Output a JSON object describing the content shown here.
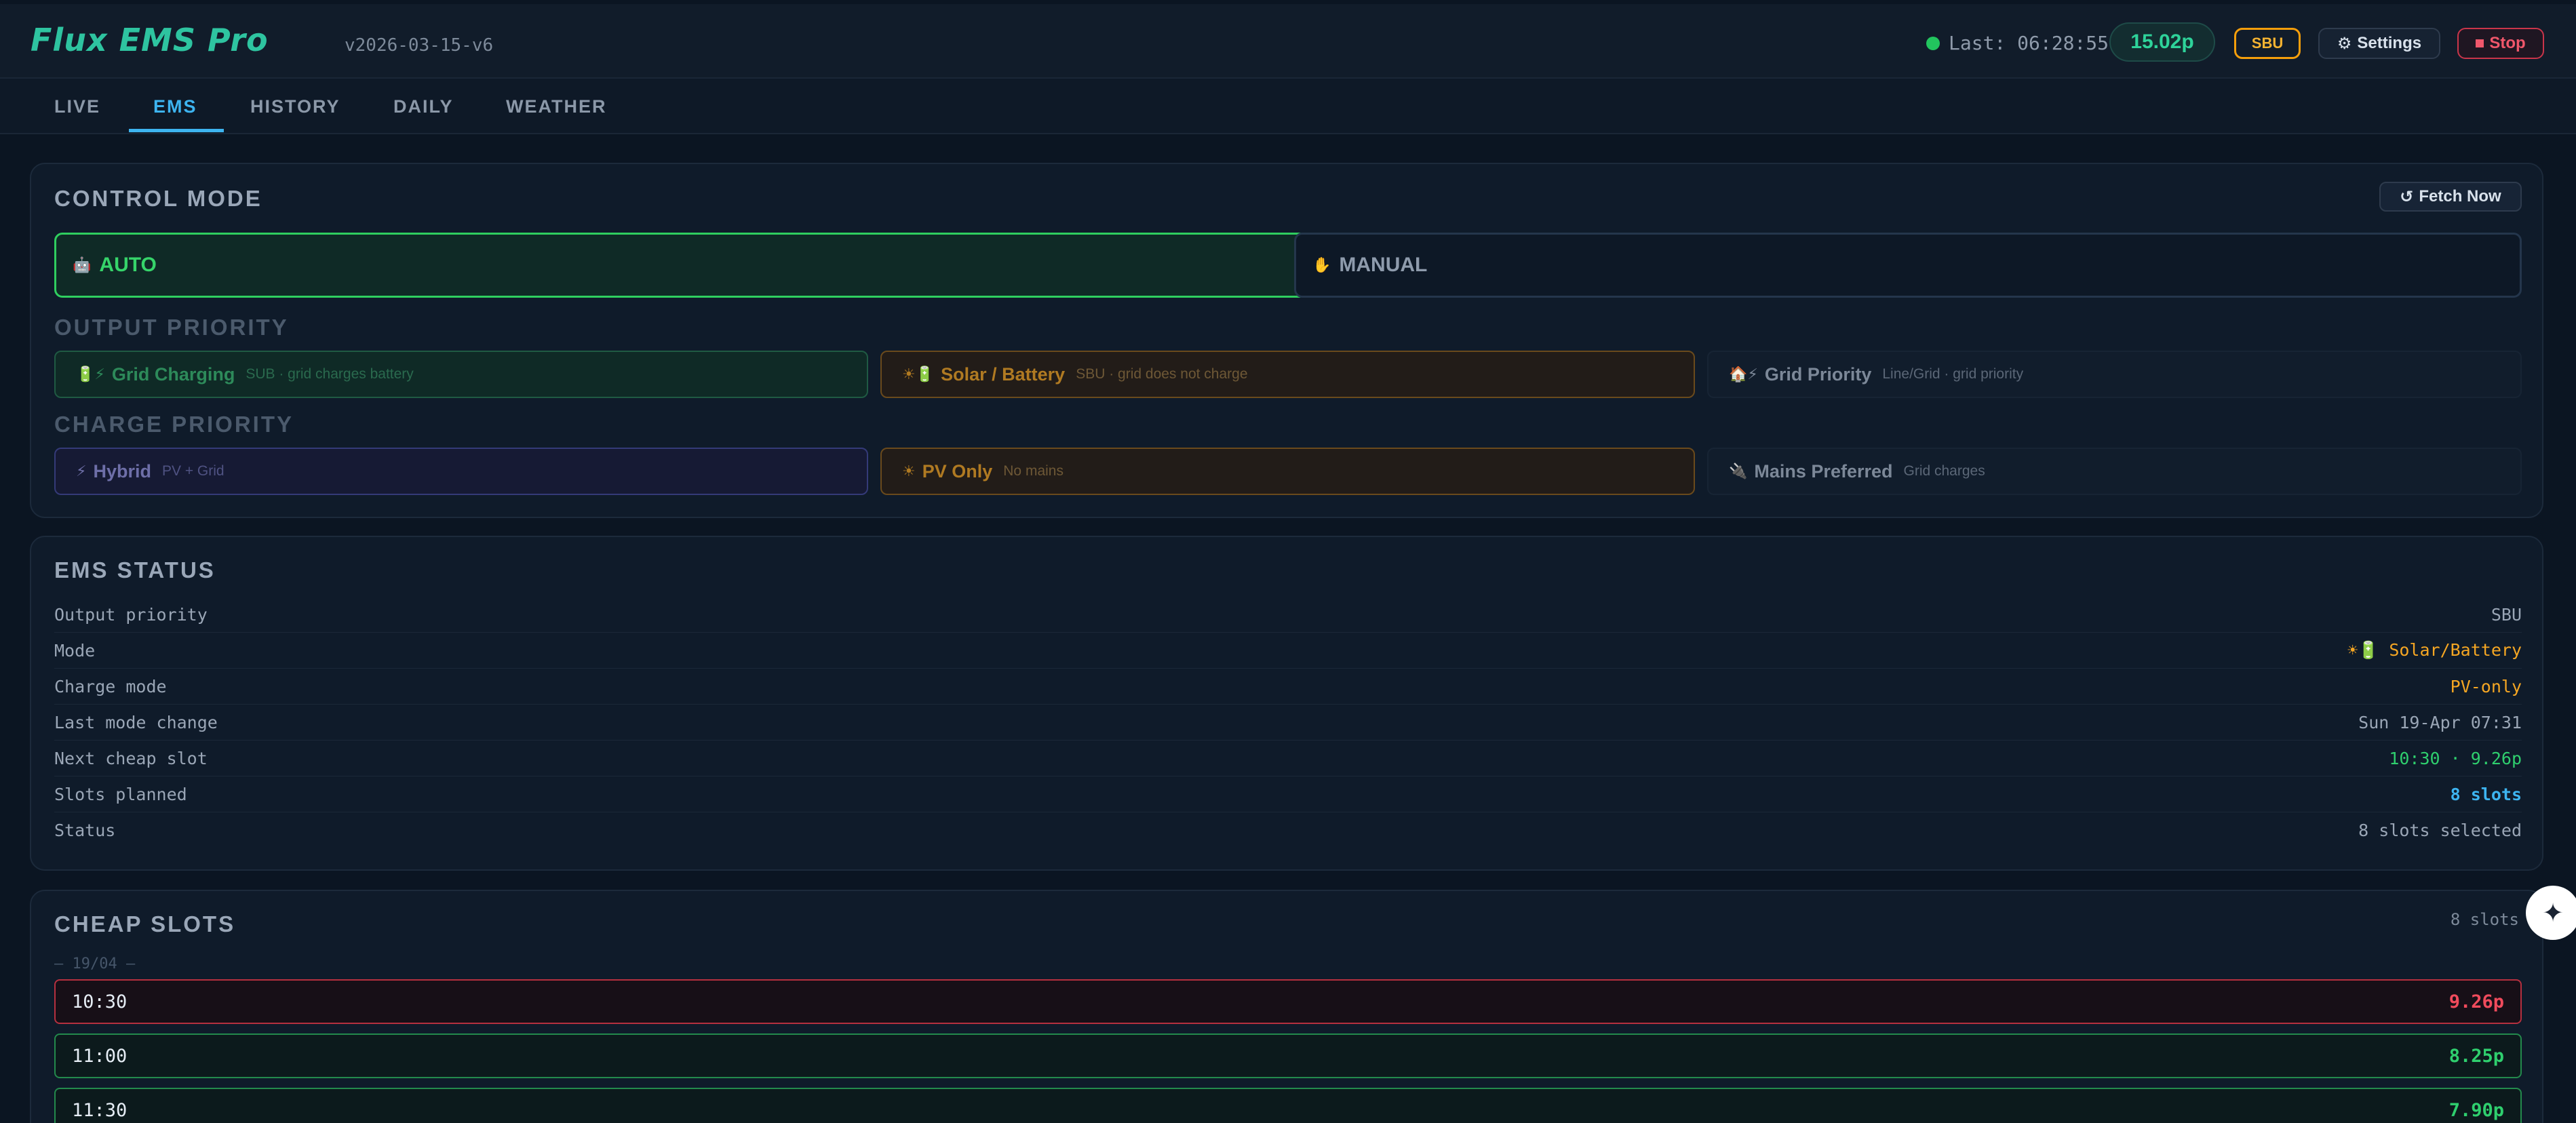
{
  "header": {
    "logo": "Flux EMS Pro",
    "version": "v2026-03-15-v6",
    "last_updated": "Last: 06:28:55",
    "price": "15.02p",
    "mode_badge": "SBU",
    "settings_label": "Settings",
    "stop_label": "Stop",
    "colors": {
      "accent": "#3db4f0",
      "success": "#22c55e",
      "warning": "#f59e0b",
      "danger": "#f0576b"
    }
  },
  "tabs": [
    {
      "label": "LIVE"
    },
    {
      "label": "EMS"
    },
    {
      "label": "HISTORY"
    },
    {
      "label": "DAILY"
    },
    {
      "label": "WEATHER"
    }
  ],
  "active_tab": "EMS",
  "control": {
    "title": "CONTROL MODE",
    "fetch_label": "Fetch Now",
    "auto_label": "AUTO",
    "manual_label": "MANUAL",
    "selected": "AUTO",
    "output_title": "OUTPUT PRIORITY",
    "output_options": [
      {
        "label": "Grid Charging",
        "desc": "SUB · grid charges battery",
        "icon": "battery-lightning-icon"
      },
      {
        "label": "Solar / Battery",
        "desc": "SBU · grid does not charge",
        "icon": "sun-battery-icon"
      },
      {
        "label": "Grid Priority",
        "desc": "Line/Grid · grid priority",
        "icon": "house-lightning-icon"
      }
    ],
    "charge_title": "CHARGE PRIORITY",
    "charge_options": [
      {
        "label": "Hybrid",
        "desc": "PV + Grid",
        "icon": "lightning-icon"
      },
      {
        "label": "PV Only",
        "desc": "No mains",
        "icon": "sun-icon"
      },
      {
        "label": "Mains Preferred",
        "desc": "Grid charges",
        "icon": "plug-icon"
      }
    ]
  },
  "ems_status": {
    "title": "EMS STATUS",
    "rows": [
      {
        "key": "Output priority",
        "value": "SBU"
      },
      {
        "key": "Mode",
        "value": "☀🔋 Solar/Battery"
      },
      {
        "key": "Charge mode",
        "value": "PV-only"
      },
      {
        "key": "Last mode change",
        "value": "Sun 19-Apr 07:31"
      },
      {
        "key": "Next cheap slot",
        "value": "10:30 · 9.26p"
      },
      {
        "key": "Slots planned",
        "value": "8 slots"
      },
      {
        "key": "Status",
        "value": "8 slots selected"
      }
    ]
  },
  "cheap_slots": {
    "title": "CHEAP SLOTS",
    "count": "8 slots",
    "date_separator": "— 19/04 —",
    "slots": [
      {
        "time": "10:30",
        "price": "9.26p"
      },
      {
        "time": "11:00",
        "price": "8.25p"
      },
      {
        "time": "11:30",
        "price": "7.90p"
      }
    ]
  }
}
